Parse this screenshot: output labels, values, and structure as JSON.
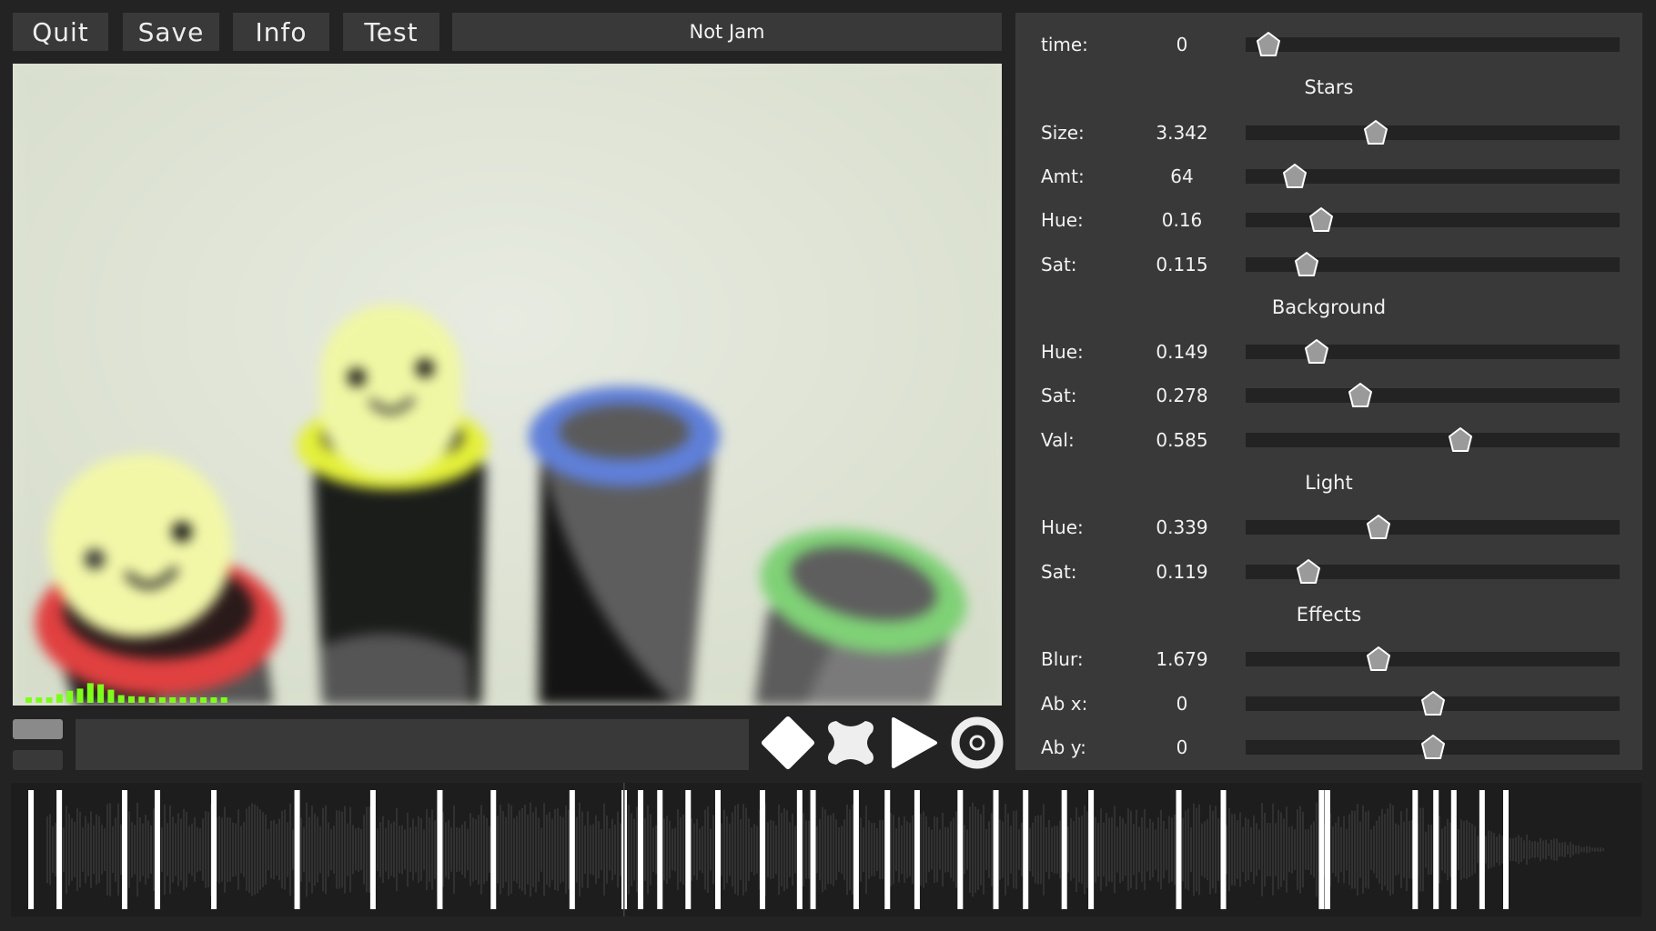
{
  "toolbar": {
    "buttons": [
      {
        "label": "Quit"
      },
      {
        "label": "Save"
      },
      {
        "label": "Info"
      },
      {
        "label": "Test"
      }
    ],
    "title": "Not Jam"
  },
  "viewport": {
    "scene_description": "Blurred 3D scene: two yellow smiling capsule characters in black tubes with red and yellow rings, two empty tubes with blue and green rings, pale green background",
    "spectrum_color": "#7dff1a",
    "spectrum_levels": [
      0.2,
      0.25,
      0.2,
      0.4,
      0.55,
      0.65,
      0.9,
      0.85,
      0.6,
      0.35,
      0.3,
      0.28,
      0.25,
      0.25,
      0.25,
      0.25,
      0.25,
      0.25,
      0.25,
      0.25
    ]
  },
  "transport": {
    "controls": [
      {
        "name": "diamond-icon"
      },
      {
        "name": "cross-icon"
      },
      {
        "name": "play-icon"
      },
      {
        "name": "record-icon"
      }
    ]
  },
  "panel": {
    "time": {
      "label": "time:",
      "value": "0",
      "fraction": 0.03
    },
    "sections": [
      {
        "title": "Stars",
        "sliders": [
          {
            "label": "Size:",
            "value": "3.342",
            "fraction": 0.336
          },
          {
            "label": "Amt:",
            "value": "64",
            "fraction": 0.105
          },
          {
            "label": "Hue:",
            "value": "0.16",
            "fraction": 0.18
          },
          {
            "label": "Sat:",
            "value": "0.115",
            "fraction": 0.139
          }
        ]
      },
      {
        "title": "Background",
        "sliders": [
          {
            "label": "Hue:",
            "value": "0.149",
            "fraction": 0.168
          },
          {
            "label": "Sat:",
            "value": "0.278",
            "fraction": 0.292
          },
          {
            "label": "Val:",
            "value": "0.585",
            "fraction": 0.579
          }
        ]
      },
      {
        "title": "Light",
        "sliders": [
          {
            "label": "Hue:",
            "value": "0.339",
            "fraction": 0.345
          },
          {
            "label": "Sat:",
            "value": "0.119",
            "fraction": 0.143
          }
        ]
      },
      {
        "title": "Effects",
        "sliders": [
          {
            "label": "Blur:",
            "value": "1.679",
            "fraction": 0.345
          },
          {
            "label": "Ab x:",
            "value": "0",
            "fraction": 0.5
          },
          {
            "label": "Ab y:",
            "value": "0",
            "fraction": 0.5
          }
        ]
      }
    ]
  },
  "timeline": {
    "playhead_fraction": 0.376,
    "markers": [
      0.008,
      0.027,
      0.071,
      0.093,
      0.131,
      0.187,
      0.238,
      0.283,
      0.319,
      0.372,
      0.407,
      0.418,
      0.431,
      0.45,
      0.47,
      0.5,
      0.525,
      0.534,
      0.563,
      0.584,
      0.604,
      0.633,
      0.657,
      0.677,
      0.703,
      0.721,
      0.78,
      0.81,
      0.876,
      0.88,
      0.939,
      0.953,
      0.965,
      0.984,
      1.0
    ],
    "marker_color": "#ffffff",
    "waveform_color": "#3a3a3a"
  }
}
